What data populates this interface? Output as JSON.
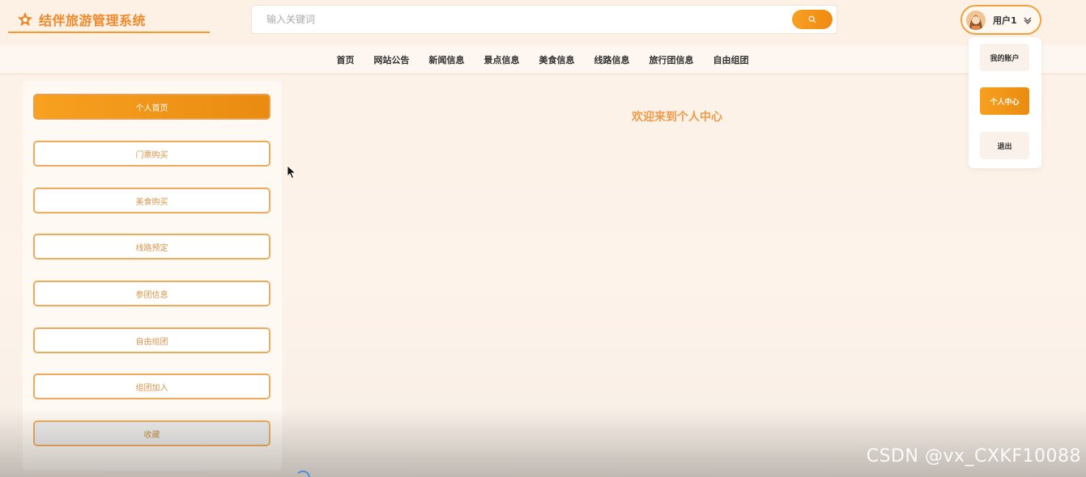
{
  "header": {
    "logo_text": "结伴旅游管理系统",
    "search_placeholder": "输入关键词",
    "user_name": "用户1"
  },
  "nav": {
    "items": [
      "首页",
      "网站公告",
      "新闻信息",
      "景点信息",
      "美食信息",
      "线路信息",
      "旅行团信息",
      "自由组团"
    ]
  },
  "sidebar": {
    "items": [
      "个人首页",
      "门票购买",
      "美食购买",
      "线路预定",
      "参团信息",
      "自由组团",
      "组团加入",
      "收藏"
    ]
  },
  "main": {
    "welcome": "欢迎来到个人中心"
  },
  "dropdown": {
    "items": [
      "我的账户",
      "个人中心",
      "退出"
    ]
  },
  "watermark": "CSDN @vx_CXKF10088",
  "colors": {
    "accent": "#f29a20",
    "accent_text": "#ee9a4a",
    "border": "#eeab5c"
  },
  "icons": {
    "logo": "star-icon",
    "search": "search-icon",
    "dropdown_toggle": "chevron-down-icon"
  }
}
